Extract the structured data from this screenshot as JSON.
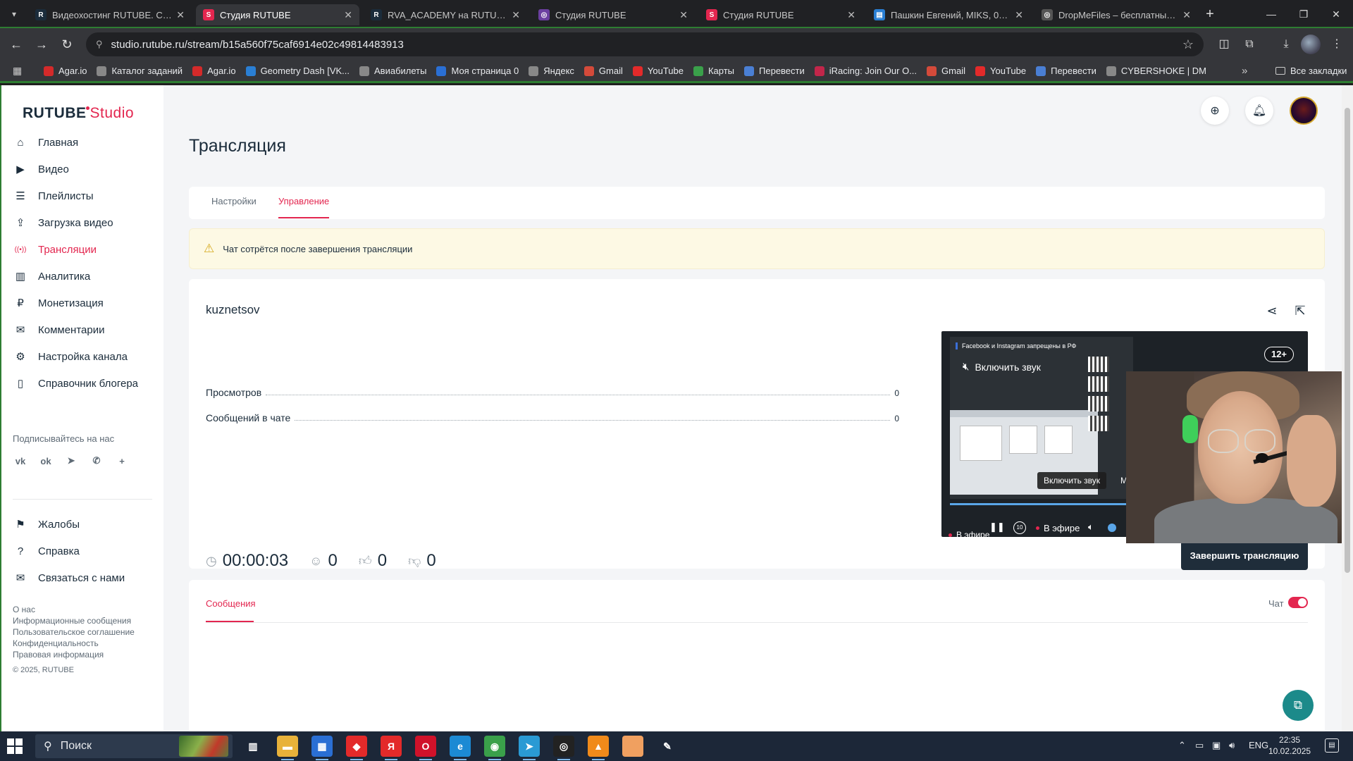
{
  "browser": {
    "tabs": [
      {
        "title": "Видеохостинг RUTUBE. Смотри...",
        "favicon": "R",
        "fav_color": "#1b2c3b",
        "active": false
      },
      {
        "title": "Студия RUTUBE",
        "favicon": "S",
        "fav_color": "#e3264f",
        "active": true
      },
      {
        "title": "RVA_ACADEMY на RUTUBE: 13...",
        "favicon": "R",
        "fav_color": "#1b2c3b",
        "active": false
      },
      {
        "title": "Студия RUTUBE",
        "favicon": "◎",
        "fav_color": "#6b3fa0",
        "active": false
      },
      {
        "title": "Студия RUTUBE",
        "favicon": "S",
        "fav_color": "#e3264f",
        "active": false
      },
      {
        "title": "Пашкин Евгений, MIKS, 04.02...",
        "favicon": "▤",
        "fav_color": "#2a7fd4",
        "active": false
      },
      {
        "title": "DropMeFiles – бесплатный фа...",
        "favicon": "◎",
        "fav_color": "#555",
        "active": false
      }
    ],
    "url": "studio.rutube.ru/stream/b15a560f75caf6914e02c49814483913",
    "bookmarks": [
      {
        "label": "Agar.io",
        "color": "#d42a2a"
      },
      {
        "label": "Каталог заданий",
        "color": "#888"
      },
      {
        "label": "Agar.io",
        "color": "#d42a2a"
      },
      {
        "label": "Geometry Dash [VK...",
        "color": "#2a7fd4"
      },
      {
        "label": "Авиабилеты",
        "color": "#888"
      },
      {
        "label": "Моя страница 0",
        "color": "#2a6fd4"
      },
      {
        "label": "Яндекс",
        "color": "#888"
      },
      {
        "label": "Gmail",
        "color": "#d44a3a"
      },
      {
        "label": "YouTube",
        "color": "#e32a2a"
      },
      {
        "label": "Карты",
        "color": "#3aa04a"
      },
      {
        "label": "Перевести",
        "color": "#4a7fd4"
      },
      {
        "label": "iRacing: Join Our O...",
        "color": "#c2264a"
      },
      {
        "label": "Gmail",
        "color": "#d44a3a"
      },
      {
        "label": "YouTube",
        "color": "#e32a2a"
      },
      {
        "label": "Перевести",
        "color": "#4a7fd4"
      },
      {
        "label": "CYBERSHOKE | DM",
        "color": "#888"
      }
    ],
    "bookmarks_all": "Все закладки"
  },
  "logo": {
    "main": "RUTUBE",
    "studio": "Studio"
  },
  "sidebar": {
    "items": [
      {
        "label": "Главная",
        "icon": "home-icon",
        "active": false
      },
      {
        "label": "Видео",
        "icon": "video-icon",
        "active": false
      },
      {
        "label": "Плейлисты",
        "icon": "playlist-icon",
        "active": false
      },
      {
        "label": "Загрузка видео",
        "icon": "upload-icon",
        "active": false
      },
      {
        "label": "Трансляции",
        "icon": "broadcast-icon",
        "active": true
      },
      {
        "label": "Аналитика",
        "icon": "analytics-icon",
        "active": false
      },
      {
        "label": "Монетизация",
        "icon": "monetization-icon",
        "active": false
      },
      {
        "label": "Комментарии",
        "icon": "comments-icon",
        "active": false
      },
      {
        "label": "Настройка канала",
        "icon": "gear-icon",
        "active": false
      },
      {
        "label": "Справочник блогера",
        "icon": "book-icon",
        "active": false
      }
    ],
    "follow_title": "Подписывайтесь на нас",
    "socials": [
      "vk-icon",
      "ok-icon",
      "telegram-icon",
      "viber-icon",
      "plus-icon"
    ],
    "items2": [
      {
        "label": "Жалобы",
        "icon": "flag-icon"
      },
      {
        "label": "Справка",
        "icon": "help-icon"
      },
      {
        "label": "Связаться с нами",
        "icon": "mail-icon"
      }
    ],
    "footer_links": [
      "О нас",
      "Информационные сообщения",
      "Пользовательское соглашение",
      "Конфиденциальность",
      "Правовая информация"
    ],
    "copyright": "© 2025, RUTUBE"
  },
  "page": {
    "title": "Трансляция",
    "tabs": [
      "Настройки",
      "Управление"
    ],
    "active_tab": "Управление",
    "warning": "Чат сотрётся после завершения трансляции"
  },
  "stream": {
    "name": "kuznetsov",
    "stats": [
      {
        "label": "Просмотров",
        "value": "0"
      },
      {
        "label": "Сообщений в чате",
        "value": "0"
      }
    ],
    "duration": "00:00:03",
    "viewers": "0",
    "likes": "0",
    "dislikes": "0",
    "end_button": "Завершить трансляцию"
  },
  "player": {
    "fb_note": "Facebook и Instagram запрещены в РФ",
    "unmute": "Включить звук",
    "age": "12+",
    "tooltip": "Включить звук",
    "tooltip_extra": "M",
    "live_left": "В эфире",
    "live_right": "В эфире",
    "rewind": "10"
  },
  "messages": {
    "tab": "Сообщения",
    "chat_label": "Чат",
    "chat_enabled": true
  },
  "taskbar": {
    "search": "Поиск",
    "lang": "ENG",
    "time": "22:35",
    "date": "10.02.2025",
    "apps": [
      {
        "icon": "task-view-icon",
        "color": "transparent",
        "glyph": "▥"
      },
      {
        "icon": "file-explorer-icon",
        "color": "#e8b23a",
        "glyph": "▬"
      },
      {
        "icon": "store-icon",
        "color": "#2a6fd4",
        "glyph": "▦"
      },
      {
        "icon": "red-diamond-app-icon",
        "color": "#e32a2a",
        "glyph": "◆"
      },
      {
        "icon": "yandex-browser-icon",
        "color": "#e32a2a",
        "glyph": "Я"
      },
      {
        "icon": "opera-icon",
        "color": "#d0122a",
        "glyph": "O"
      },
      {
        "icon": "edge-icon",
        "color": "#1c8ad4",
        "glyph": "e"
      },
      {
        "icon": "chrome-icon",
        "color": "#3aa04a",
        "glyph": "◉"
      },
      {
        "icon": "telegram-app-icon",
        "color": "#2a9ad4",
        "glyph": "➤"
      },
      {
        "icon": "steam-icon",
        "color": "#222",
        "glyph": "◎"
      },
      {
        "icon": "vlc-icon",
        "color": "#f08a1a",
        "glyph": "▲"
      },
      {
        "icon": "orange-app-icon",
        "color": "#f0a060",
        "glyph": " "
      },
      {
        "icon": "feather-app-icon",
        "color": "transparent",
        "glyph": "✎"
      }
    ]
  }
}
